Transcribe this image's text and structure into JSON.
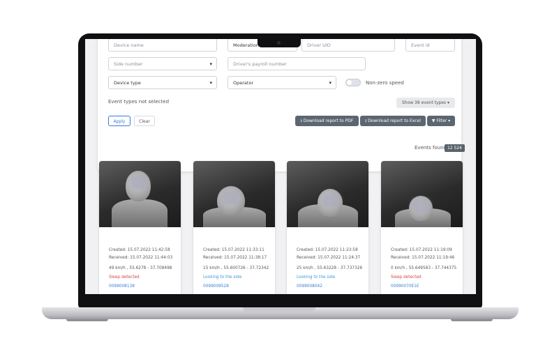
{
  "filters": {
    "device_name_placeholder": "Device name",
    "moderation_label": "Moderation",
    "driver_uid_placeholder": "Driver UID",
    "event_id_placeholder": "Event id",
    "side_number_label": "Side number",
    "payroll_placeholder": "Driver's payroll number",
    "device_type_label": "Device type",
    "operator_label": "Operator",
    "non_zero_speed_label": "Non-zero speed",
    "event_types_status": "Event types not selected",
    "show_event_types_label": "Show 38 event types"
  },
  "actions": {
    "apply_label": "Apply",
    "clear_label": "Clear",
    "download_pdf_label": "Download report to PDF",
    "download_excel_label": "Download report to Excel",
    "filter_label": "Filter"
  },
  "results": {
    "found_label": "Events found",
    "found_count": "12 524"
  },
  "cards": [
    {
      "created": "Created: 15.07.2022 11:42:58",
      "received": "Received: 15.07.2022 11:44:03",
      "location": "49 km/h , 55.6278 - 37.708498",
      "event": "Sleep detected",
      "event_color": "#d64545",
      "device": "0099008138"
    },
    {
      "created": "Created: 15.07.2022 11:33:11",
      "received": "Received: 15.07.2022 11:38:17",
      "location": "15 km/h , 55.600726 - 37.72342",
      "event": "Looking to the side",
      "event_color": "#3a9ad9",
      "device": "0099009528"
    },
    {
      "created": "Created: 15.07.2022 11:23:58",
      "received": "Received: 15.07.2022 11:24:37",
      "location": "25 km/h , 55.63228 - 37.737326",
      "event": "Looking to the side",
      "event_color": "#3a9ad9",
      "device": "0099008042"
    },
    {
      "created": "Created: 15.07.2022 11:19:09",
      "received": "Received: 15.07.2022 11:19:46",
      "location": "0 km/h , 55.649583 - 37.744375",
      "event": "Sleep detected",
      "event_color": "#d64545",
      "device": "00990070E1E"
    }
  ]
}
